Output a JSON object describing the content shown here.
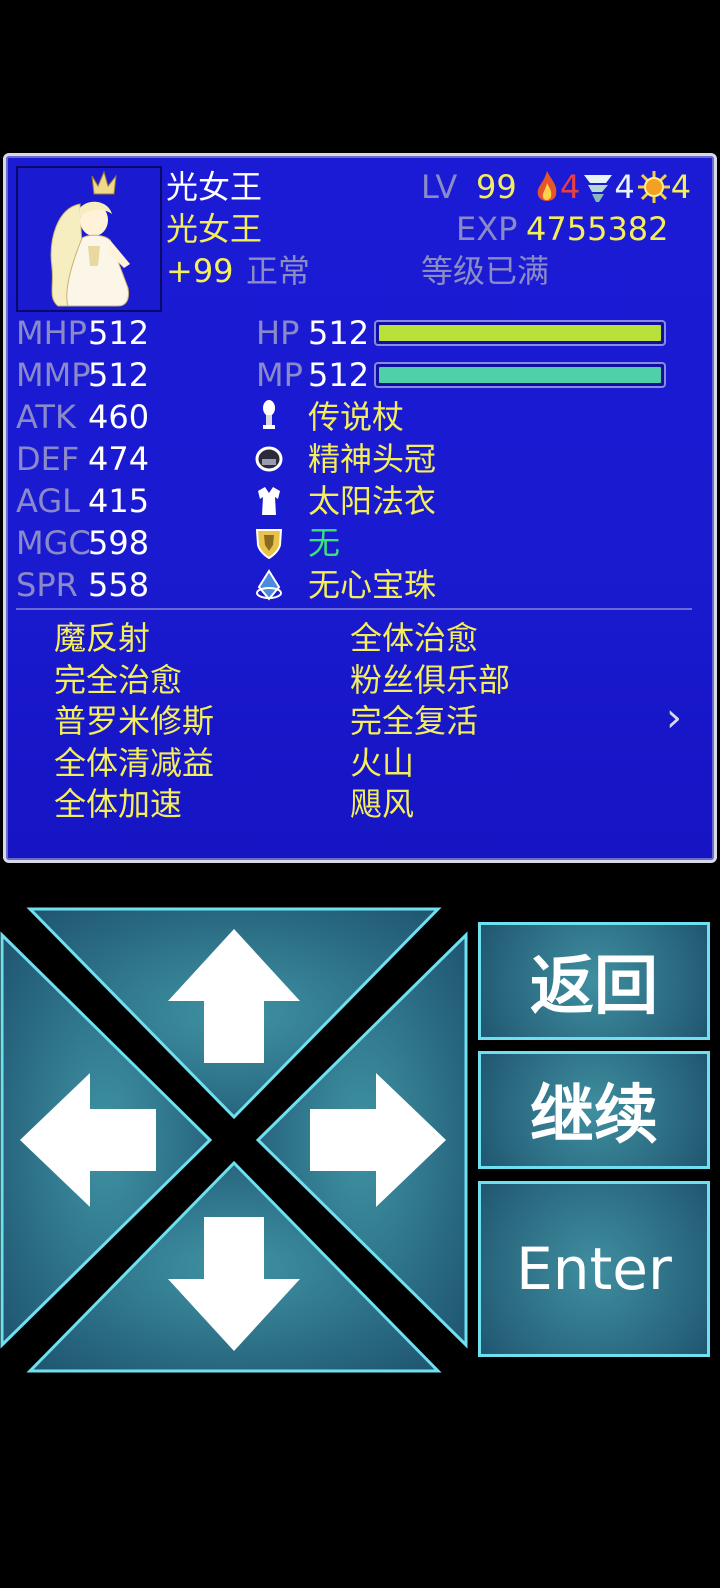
{
  "character": {
    "name": "光女王",
    "class": "光女王",
    "bonus": "+99",
    "status": "正常",
    "lv_label": "LV",
    "lv": "99",
    "exp_label": "EXP",
    "exp": "4755382",
    "level_note": "等级已满",
    "element_counts": [
      {
        "icon": "fire-icon",
        "count": "4"
      },
      {
        "icon": "wind-icon",
        "count": "4"
      },
      {
        "icon": "sun-icon",
        "count": "4"
      }
    ]
  },
  "stats": [
    {
      "label": "MHP",
      "value": "512"
    },
    {
      "label": "MMP",
      "value": "512"
    },
    {
      "label": "ATK",
      "value": "460"
    },
    {
      "label": "DEF",
      "value": "474"
    },
    {
      "label": "AGL",
      "value": "415"
    },
    {
      "label": "MGC",
      "value": "598"
    },
    {
      "label": "SPR",
      "value": "558"
    }
  ],
  "gauges": [
    {
      "label": "HP",
      "value": "512",
      "fraction": 1.0,
      "color": "#b8e23a"
    },
    {
      "label": "MP",
      "value": "512",
      "fraction": 1.0,
      "color": "#4fd0a8"
    }
  ],
  "equipment": [
    {
      "icon": "staff-icon",
      "name": "传说杖",
      "color": "#f4ee5a"
    },
    {
      "icon": "helmet-icon",
      "name": "精神头冠",
      "color": "#f4ee5a"
    },
    {
      "icon": "robe-icon",
      "name": "太阳法衣",
      "color": "#f4ee5a"
    },
    {
      "icon": "shield-icon",
      "name": "无",
      "color": "#3de27a"
    },
    {
      "icon": "orb-icon",
      "name": "无心宝珠",
      "color": "#f4ee5a"
    }
  ],
  "skills_left": [
    "魔反射",
    "完全治愈",
    "普罗米修斯",
    "全体清减益",
    "全体加速"
  ],
  "skills_right": [
    "全体治愈",
    "粉丝俱乐部",
    "完全复活",
    "火山",
    "飓风"
  ],
  "next_page_glyph": "›",
  "buttons": {
    "back": "返回",
    "continue": "继续",
    "enter": "Enter"
  },
  "dpad": {
    "up": "up-arrow-icon",
    "down": "down-arrow-icon",
    "left": "left-arrow-icon",
    "right": "right-arrow-icon"
  }
}
